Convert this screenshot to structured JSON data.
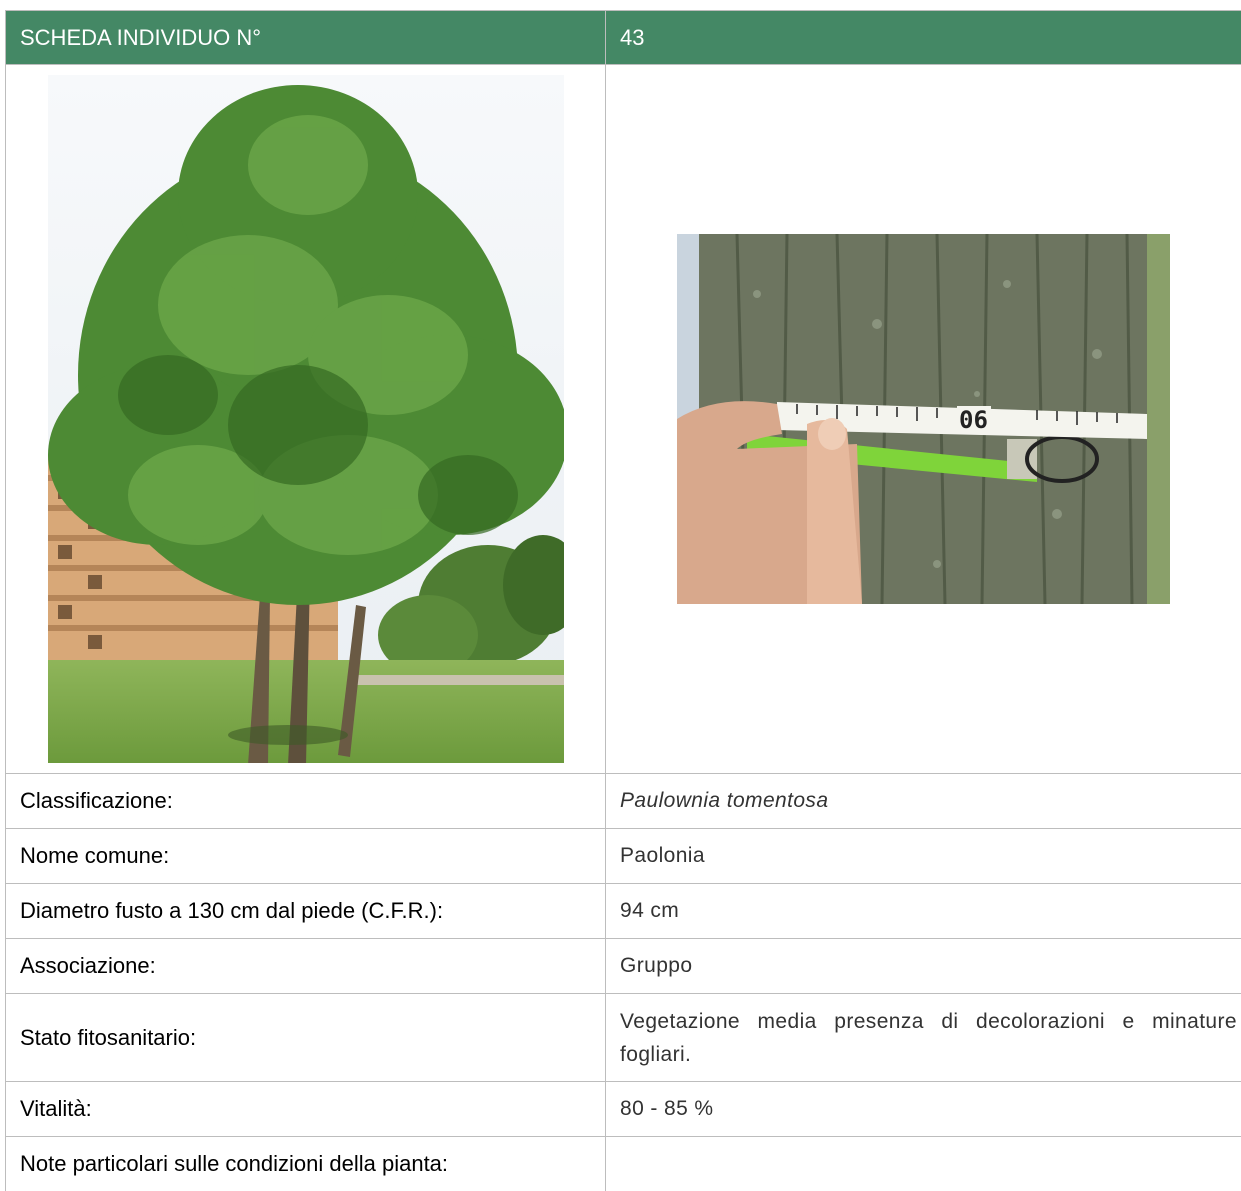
{
  "header": {
    "left": "SCHEDA INDIVIDUO N°",
    "right": "43"
  },
  "photos": {
    "tree": "photo-tree",
    "trunk_measure": "photo-trunk-measure"
  },
  "rows": [
    {
      "label": "Classificazione:",
      "value": "Paulownia tomentosa"
    },
    {
      "label": "Nome comune:",
      "value": "Paolonia"
    },
    {
      "label": "Diametro fusto a 130 cm dal piede (C.F.R.):",
      "value": "94 cm"
    },
    {
      "label": "Associazione:",
      "value": "Gruppo"
    },
    {
      "label": "Stato fitosanitario:",
      "value": "Vegetazione media presenza di decolorazioni e minature fogliari."
    },
    {
      "label": "Vitalità:",
      "value": "80 - 85 %"
    },
    {
      "label": "Note particolari sulle condizioni della pianta:",
      "value": ""
    }
  ],
  "colors": {
    "header_bg": "#448865",
    "header_text": "#ffffff",
    "border": "#bdbdbd"
  }
}
